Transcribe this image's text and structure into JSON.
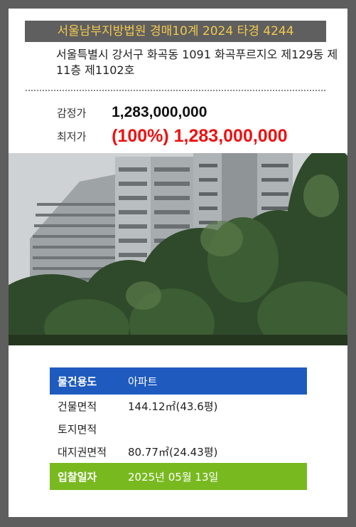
{
  "header": {
    "title": "서울남부지방법원 경매10계 2024 타경 4244",
    "title_color": "#f2c94c"
  },
  "property": {
    "address": "서울특별시 강서구 화곡동 1091 화곡푸르지오 제129동 제11층 제1102호"
  },
  "prices": {
    "appraisal_label": "감정가",
    "appraisal_value": "1,283,000,000",
    "minimum_label": "최저가",
    "minimum_value": "(100%) 1,283,000,000",
    "minimum_color": "#ee1111"
  },
  "photo": {
    "description_icon": "apartment-photo"
  },
  "info": {
    "rows": [
      {
        "label": "물건용도",
        "value": "아파트"
      },
      {
        "label": "건물면적",
        "value": "144.12㎡(43.6평)"
      },
      {
        "label": "토지면적",
        "value": ""
      },
      {
        "label": "대지권면적",
        "value": "80.77㎡(24.43평)"
      },
      {
        "label": "입찰일자",
        "value": "2025년 05월 13일"
      }
    ],
    "accent_blue": "#1f5bbf",
    "accent_green": "#78b920"
  }
}
